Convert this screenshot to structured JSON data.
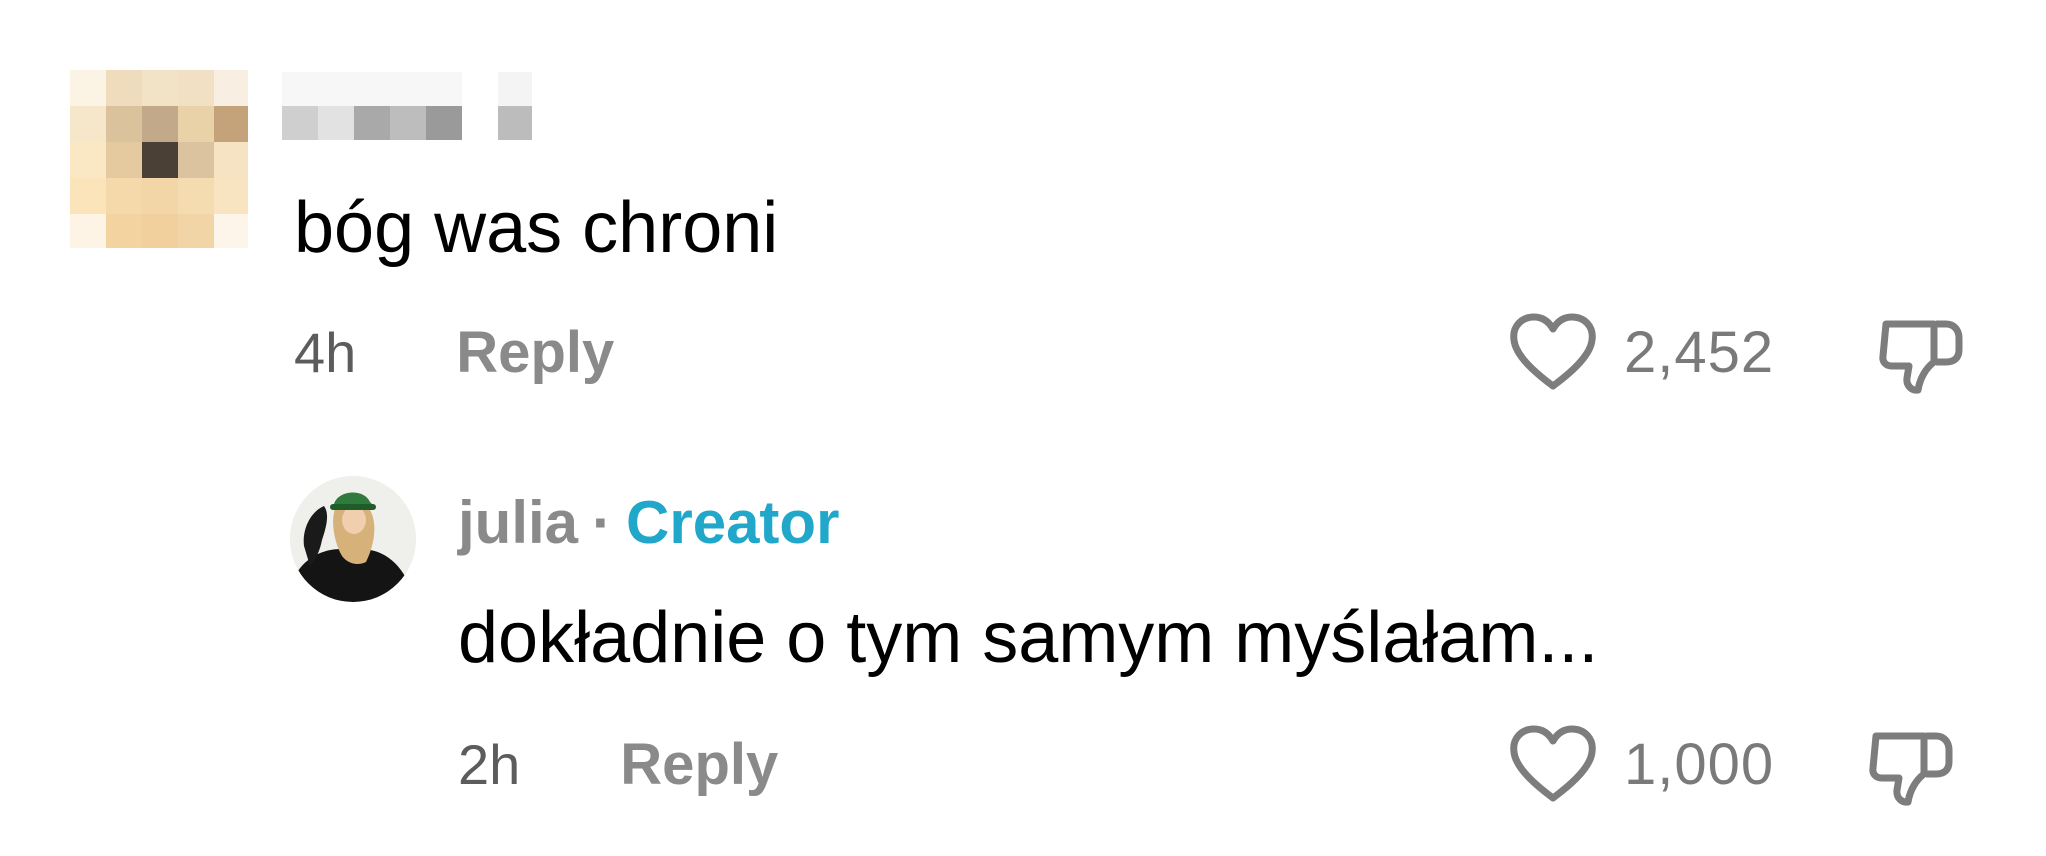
{
  "comments": [
    {
      "author": "",
      "author_blurred": true,
      "text": "bóg was chroni",
      "time": "4h",
      "reply_label": "Reply",
      "likes": "2,452"
    },
    {
      "author": "julia",
      "separator": "·",
      "badge": "Creator",
      "text": "dokładnie o tym samym myślałam...",
      "time": "2h",
      "reply_label": "Reply",
      "likes": "1,000"
    }
  ],
  "icons": {
    "like": "heart-outline-icon",
    "dislike": "thumbs-down-icon"
  },
  "colors": {
    "creator_badge": "#20a7c9",
    "secondary_text": "#8a8a8a",
    "primary_text": "#000000"
  }
}
